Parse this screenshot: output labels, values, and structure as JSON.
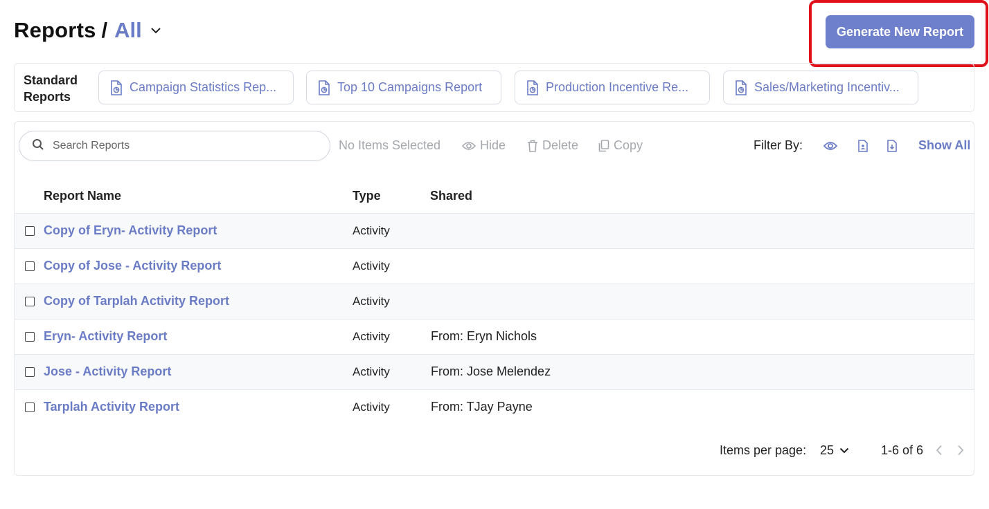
{
  "header": {
    "title": "Reports",
    "separator": "/",
    "scope": "All"
  },
  "actions": {
    "generate_label": "Generate New Report"
  },
  "standard_reports": {
    "label_line1": "Standard",
    "label_line2": "Reports",
    "items": [
      {
        "label": "Campaign Statistics Rep..."
      },
      {
        "label": "Top 10 Campaigns Report"
      },
      {
        "label": "Production Incentive Re..."
      },
      {
        "label": "Sales/Marketing Incentiv..."
      }
    ]
  },
  "toolbar": {
    "search_placeholder": "Search Reports",
    "selection_status": "No Items Selected",
    "hide_label": "Hide",
    "delete_label": "Delete",
    "copy_label": "Copy",
    "filter_label": "Filter By:",
    "show_all_label": "Show All"
  },
  "table": {
    "columns": [
      "Report Name",
      "Type",
      "Shared"
    ],
    "rows": [
      {
        "name": "Copy of Eryn- Activity Report",
        "type": "Activity",
        "shared": ""
      },
      {
        "name": "Copy of Jose - Activity Report",
        "type": "Activity",
        "shared": ""
      },
      {
        "name": "Copy of Tarplah Activity Report",
        "type": "Activity",
        "shared": ""
      },
      {
        "name": "Eryn- Activity Report",
        "type": "Activity",
        "shared": "From: Eryn Nichols"
      },
      {
        "name": "Jose - Activity Report",
        "type": "Activity",
        "shared": "From: Jose Melendez"
      },
      {
        "name": "Tarplah Activity Report",
        "type": "Activity",
        "shared": "From: TJay Payne"
      }
    ]
  },
  "pagination": {
    "items_per_page_label": "Items per page:",
    "items_per_page_value": "25",
    "range": "1-6 of 6"
  },
  "colors": {
    "accent": "#6b7cc6",
    "button": "#6e7fcb",
    "highlight": "#e0101a"
  },
  "icons": [
    "chevron-down-icon",
    "report-doc-icon",
    "search-icon",
    "eye-icon",
    "trash-icon",
    "copy-icon",
    "doc-person-icon",
    "doc-download-icon",
    "chevron-left-icon",
    "chevron-right-icon"
  ]
}
